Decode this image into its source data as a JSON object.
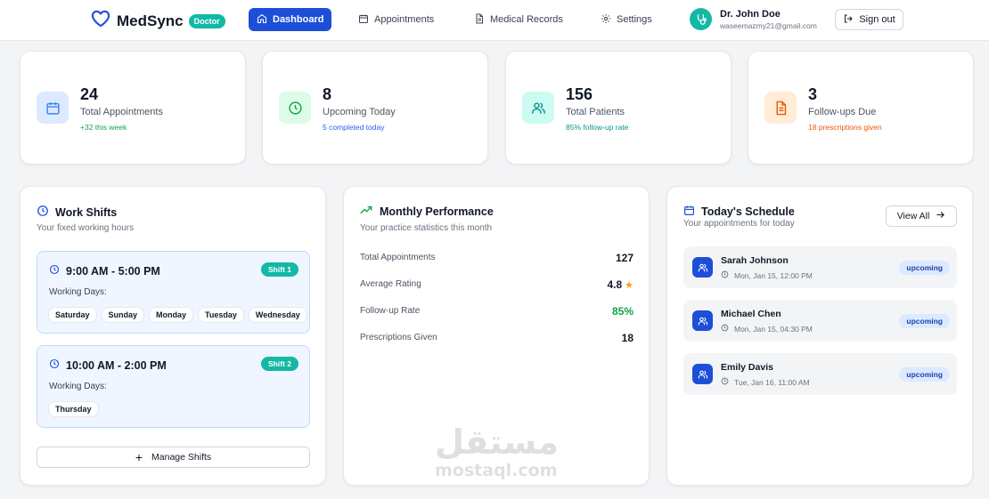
{
  "nav": {
    "brand": "MedSync",
    "badge": "Doctor",
    "items": [
      {
        "label": "Dashboard",
        "icon": "home-icon"
      },
      {
        "label": "Appointments",
        "icon": "calendar-icon"
      },
      {
        "label": "Medical Records",
        "icon": "document-icon"
      },
      {
        "label": "Settings",
        "icon": "gear-icon"
      }
    ],
    "user": {
      "name": "Dr. John Doe",
      "email": "waseemazmy21@gmail.com"
    },
    "signout": "Sign out"
  },
  "stats": [
    {
      "value": "24",
      "label": "Total Appointments",
      "sub": "+32 this week",
      "icon": "calendar-icon",
      "color": "#3b82f6",
      "bg": "#dbeafe",
      "sub_color": "#16a34a"
    },
    {
      "value": "8",
      "label": "Upcoming Today",
      "sub": "5 completed today",
      "icon": "clock-icon",
      "color": "#16a34a",
      "bg": "#dcfce7",
      "sub_color": "#2563eb"
    },
    {
      "value": "156",
      "label": "Total Patients",
      "sub": "85% follow-up rate",
      "icon": "users-icon",
      "color": "#0d9488",
      "bg": "#ccfbf1",
      "sub_color": "#0d9488"
    },
    {
      "value": "3",
      "label": "Follow-ups Due",
      "sub": "18 prescriptions given",
      "icon": "document-icon",
      "color": "#ea580c",
      "bg": "#ffedd5",
      "sub_color": "#ea580c"
    }
  ],
  "shifts": {
    "title": "Work Shifts",
    "subtitle": "Your fixed working hours",
    "working_days_label": "Working Days:",
    "items": [
      {
        "time": "9:00 AM - 5:00 PM",
        "badge": "Shift 1",
        "days": [
          "Saturday",
          "Sunday",
          "Monday",
          "Tuesday",
          "Wednesday"
        ]
      },
      {
        "time": "10:00 AM - 2:00 PM",
        "badge": "Shift 2",
        "days": [
          "Thursday"
        ]
      }
    ],
    "manage": "Manage Shifts"
  },
  "performance": {
    "title": "Monthly Performance",
    "subtitle": "Your practice statistics this month",
    "rows": [
      {
        "label": "Total Appointments",
        "value": "127"
      },
      {
        "label": "Average Rating",
        "value": "4.8"
      },
      {
        "label": "Follow-up Rate",
        "value": "85%"
      },
      {
        "label": "Prescriptions Given",
        "value": "18"
      }
    ]
  },
  "schedule": {
    "title": "Today's Schedule",
    "subtitle": "Your appointments for today",
    "view_all": "View All",
    "items": [
      {
        "name": "Sarah Johnson",
        "time": "Mon, Jan 15, 12:00 PM",
        "status": "upcoming"
      },
      {
        "name": "Michael Chen",
        "time": "Mon, Jan 15, 04:30 PM",
        "status": "upcoming"
      },
      {
        "name": "Emily Davis",
        "time": "Tue, Jan 16, 11:00 AM",
        "status": "upcoming"
      }
    ]
  },
  "watermark": {
    "arabic": "مستقل",
    "latin": "mostaql.com"
  },
  "colors": {
    "primary": "#1d4ed8",
    "accent": "#14b8a6",
    "success": "#16a34a",
    "star": "#f59e0b"
  }
}
